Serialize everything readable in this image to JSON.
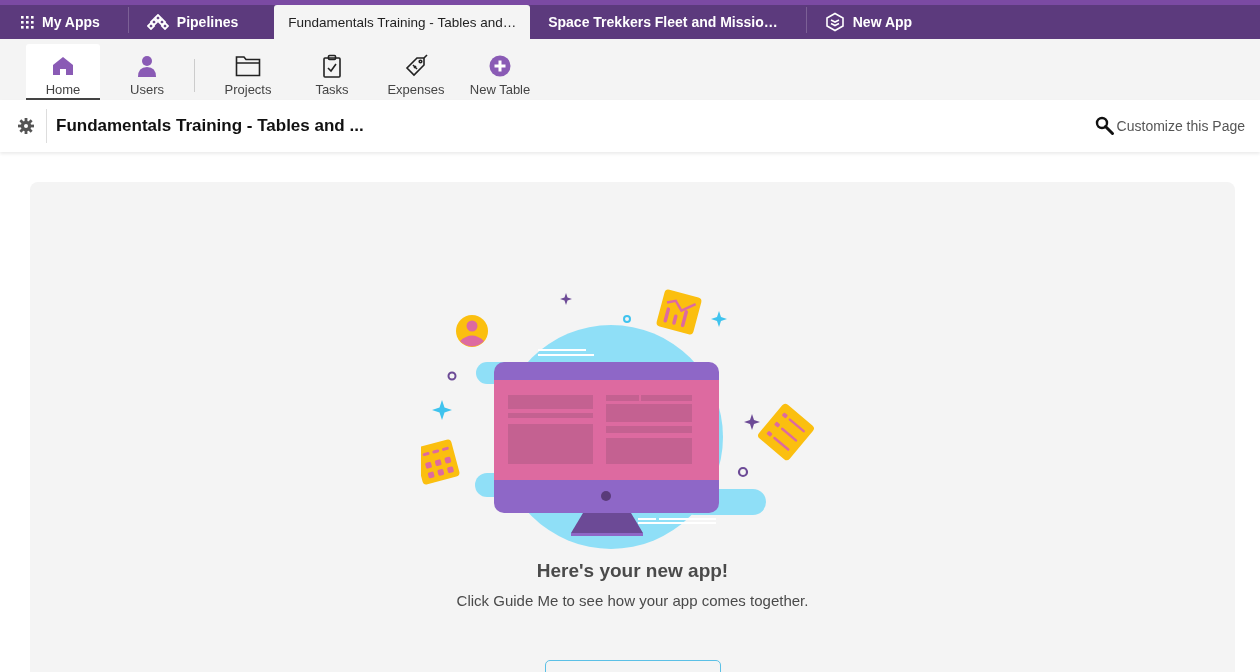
{
  "app_tabs": [
    {
      "label": "My Apps",
      "selected": false
    },
    {
      "label": "Pipelines",
      "selected": false
    },
    {
      "label": "Fundamentals Training - Tables and…",
      "selected": true
    },
    {
      "label": "Space Trekkers Fleet and Missio…",
      "selected": false
    },
    {
      "label": "New App",
      "selected": false
    }
  ],
  "nav_groups": [
    [
      {
        "label": "Home",
        "selected": true
      },
      {
        "label": "Users",
        "selected": false
      }
    ],
    [
      {
        "label": "Projects",
        "selected": false
      },
      {
        "label": "Tasks",
        "selected": false
      },
      {
        "label": "Expenses",
        "selected": false
      },
      {
        "label": "New Table",
        "selected": false
      }
    ]
  ],
  "page_header": {
    "title": "Fundamentals Training - Tables and ...",
    "customize_link": "Customize this Page"
  },
  "empty_state": {
    "heading": "Here's your new app!",
    "text": "Click Guide Me to see how your app comes together."
  }
}
